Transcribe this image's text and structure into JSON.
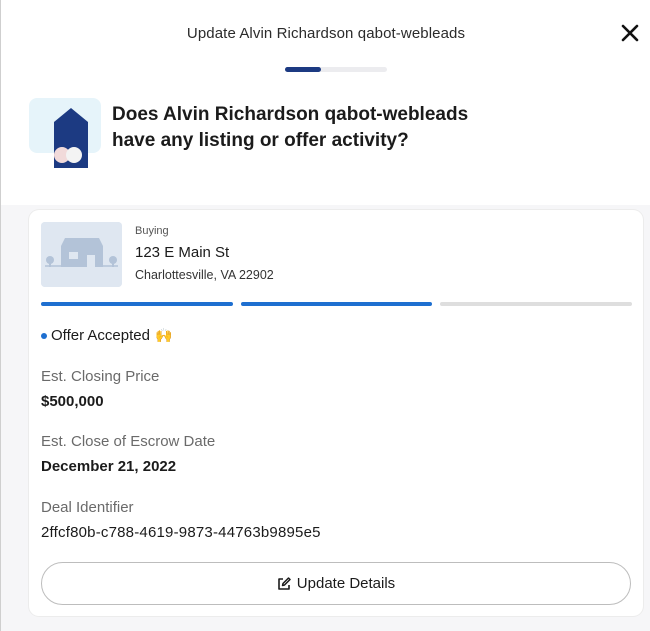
{
  "header": {
    "title": "Update Alvin Richardson qabot-webleads",
    "close_icon": "close-icon",
    "progress_fraction": 0.35
  },
  "question": {
    "icon": "house-icon",
    "text": "Does Alvin Richardson qabot-webleads have any listing or offer activity?"
  },
  "deal": {
    "type": "Buying",
    "street": "123 E Main St",
    "city": "Charlottesville, VA 22902",
    "thumbnail_icon": "house-placeholder-icon",
    "stages": [
      {
        "complete": true
      },
      {
        "complete": true
      },
      {
        "complete": false
      }
    ],
    "status": "Offer Accepted",
    "status_emoji": "🙌",
    "status_color": "#1e6fd0",
    "fields": [
      {
        "label": "Est. Closing Price",
        "value": "$500,000"
      },
      {
        "label": "Est. Close of Escrow Date",
        "value": "December 21, 2022"
      },
      {
        "label": "Deal Identifier",
        "value": "2ffcf80b-c788-4619-9873-44763b9895e5"
      }
    ],
    "update_button_label": "Update Details",
    "update_button_icon": "edit-icon"
  },
  "colors": {
    "brand_navy": "#1c3a82",
    "accent_blue": "#1e6fd0"
  }
}
